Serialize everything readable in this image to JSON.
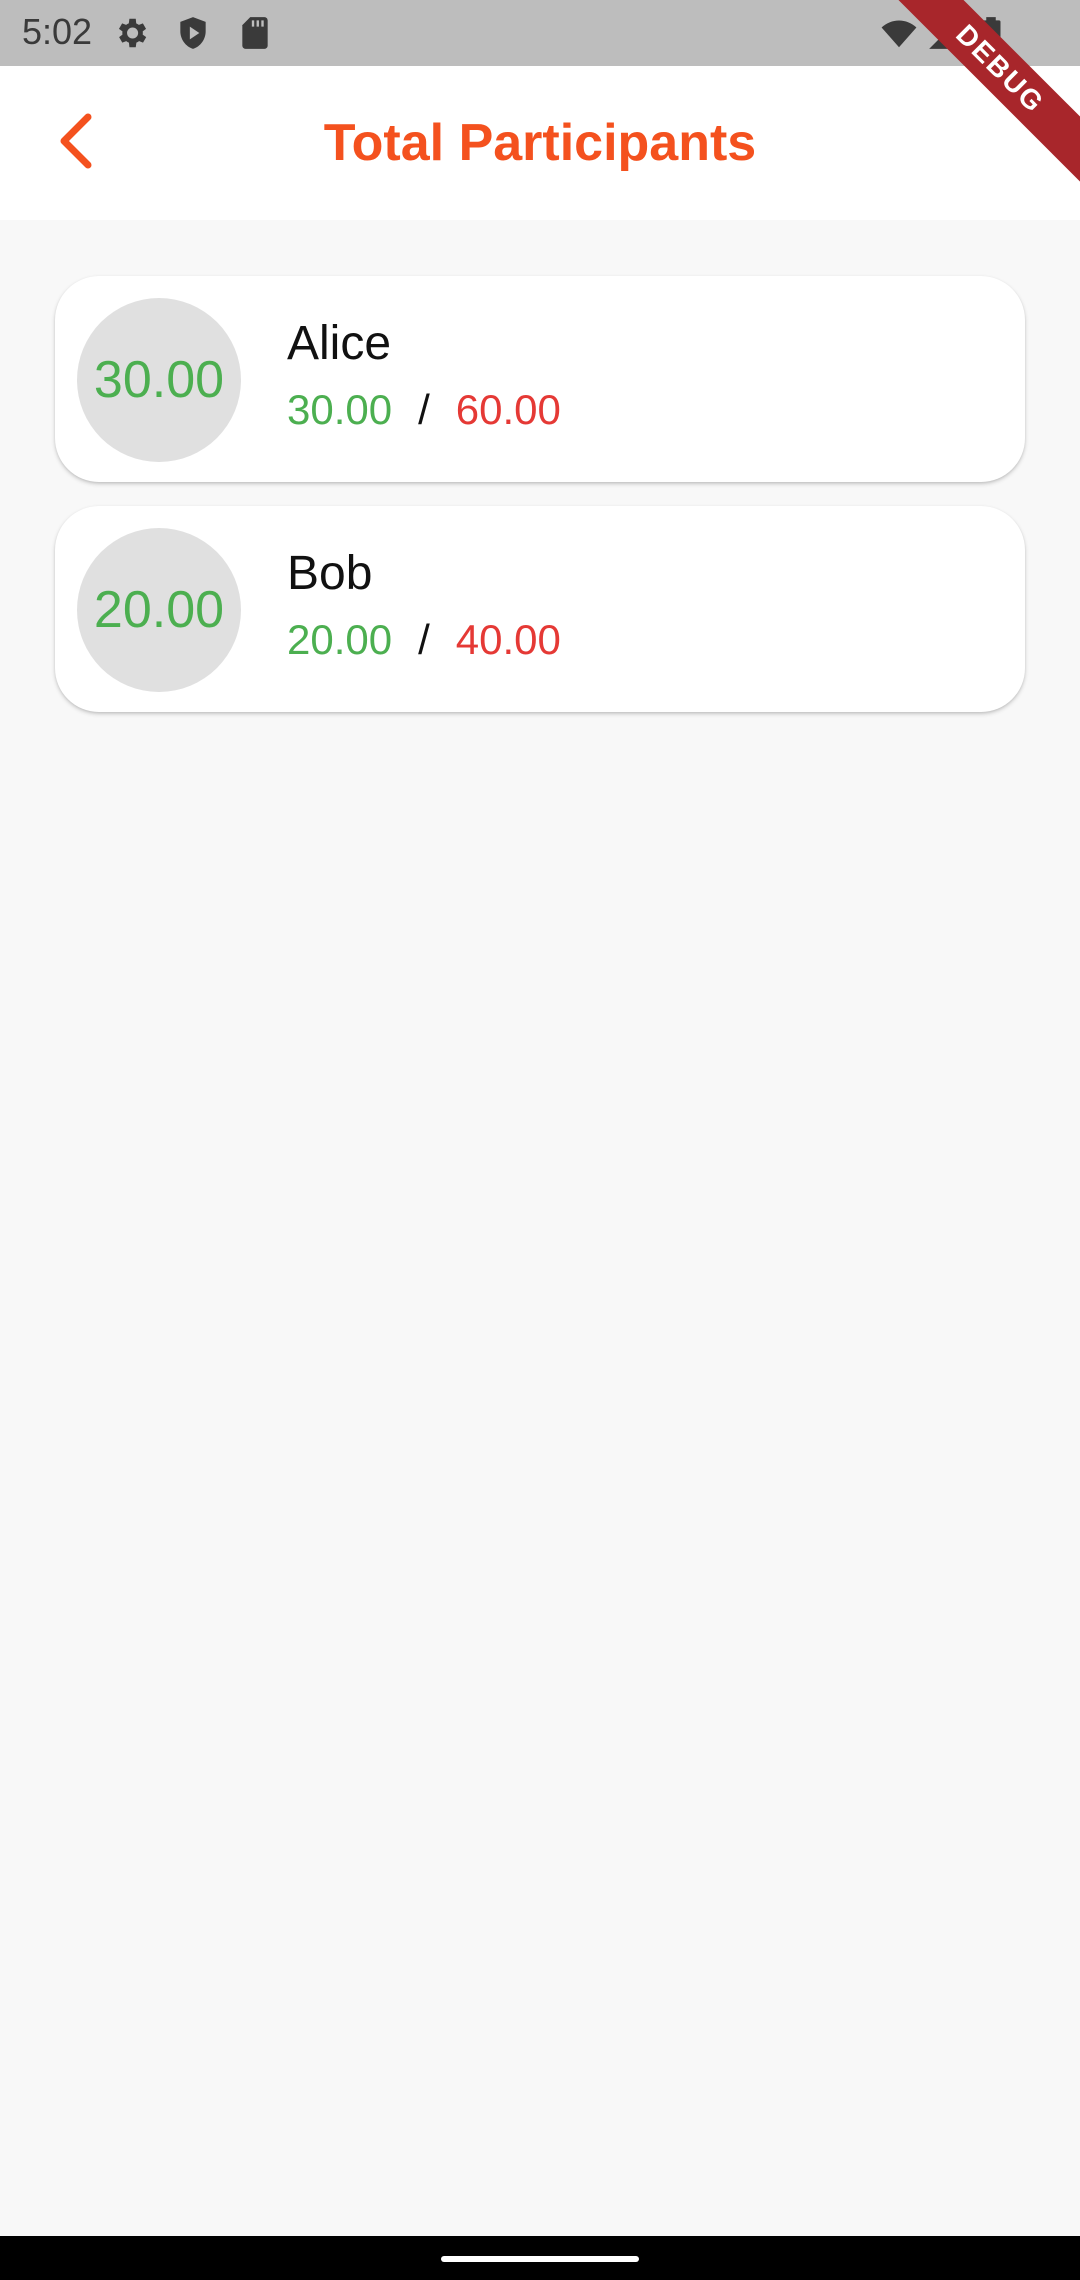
{
  "status_bar": {
    "time": "5:02",
    "left_icons": [
      "gear-icon",
      "shield-play-icon",
      "sd-card-icon"
    ],
    "right_icons": [
      "wifi-icon",
      "signal-icon",
      "battery-icon"
    ]
  },
  "debug_banner": "DEBUG",
  "app_bar": {
    "title": "Total Participants",
    "back_icon": "chevron-left-icon",
    "accent_color": "#f4511e"
  },
  "participants": [
    {
      "name": "Alice",
      "avatar_value": "30.00",
      "paid": "30.00",
      "separator": "/",
      "total": "60.00"
    },
    {
      "name": "Bob",
      "avatar_value": "20.00",
      "paid": "20.00",
      "separator": "/",
      "total": "40.00"
    }
  ],
  "colors": {
    "paid": "#4caf50",
    "total": "#e53935",
    "avatar_bg": "#e0e0e0"
  }
}
